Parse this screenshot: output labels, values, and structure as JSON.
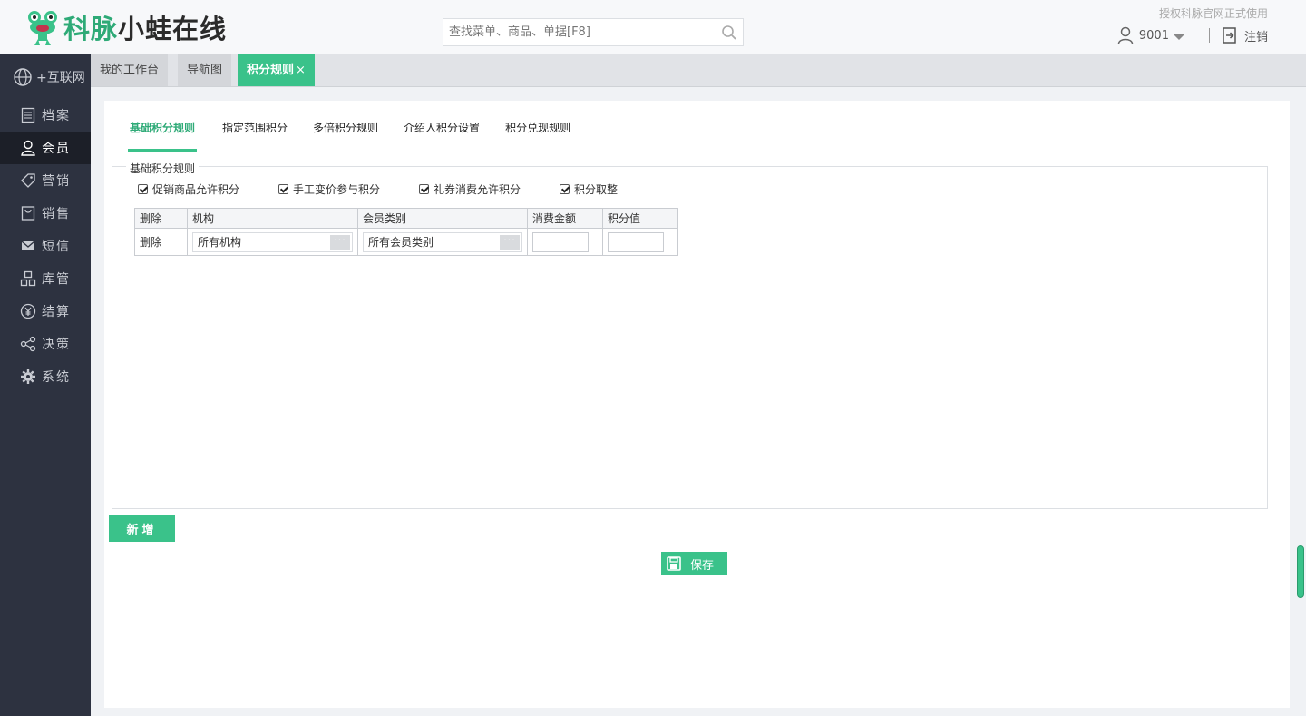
{
  "header": {
    "brand_green": "科脉",
    "brand_dark": "小蛙在线",
    "search_placeholder": "查找菜单、商品、单据[F8]",
    "authorized_text": "授权科脉官网正式使用",
    "user_id": "9001",
    "logout_label": "注销"
  },
  "sidebar": {
    "items": [
      {
        "label": "+互联网",
        "icon": "globe-icon"
      },
      {
        "label": "档案",
        "icon": "document-icon"
      },
      {
        "label": "会员",
        "icon": "user-icon"
      },
      {
        "label": "营销",
        "icon": "tag-icon"
      },
      {
        "label": "销售",
        "icon": "bag-icon"
      },
      {
        "label": "短信",
        "icon": "mail-icon"
      },
      {
        "label": "库管",
        "icon": "boxes-icon"
      },
      {
        "label": "结算",
        "icon": "yen-icon"
      },
      {
        "label": "决策",
        "icon": "share-icon"
      },
      {
        "label": "系统",
        "icon": "gear-icon"
      }
    ],
    "active_index": 2
  },
  "window_tabs": [
    {
      "label": "我的工作台"
    },
    {
      "label": "导航图"
    },
    {
      "label": "积分规则",
      "close": "×"
    }
  ],
  "sub_tabs": [
    "基础积分规则",
    "指定范围积分",
    "多倍积分规则",
    "介绍人积分设置",
    "积分兑现规则"
  ],
  "section": {
    "legend": "基础积分规则",
    "checkboxes": [
      {
        "label": "促销商品允许积分",
        "checked": true
      },
      {
        "label": "手工变价参与积分",
        "checked": true
      },
      {
        "label": "礼券消费允许积分",
        "checked": true
      },
      {
        "label": "积分取整",
        "checked": true
      }
    ]
  },
  "table": {
    "headers": [
      "删除",
      "机构",
      "会员类别",
      "消费金额",
      "积分值"
    ],
    "rows": [
      {
        "delete": "删除",
        "org": "所有机构",
        "member_type": "所有会员类别",
        "amount": "",
        "points": ""
      }
    ],
    "picker_button": "···"
  },
  "buttons": {
    "add": "新增",
    "save": "保存"
  },
  "colors": {
    "accent": "#3ac28a",
    "sidebar_bg": "#2d3240",
    "sidebar_active": "#1c1f28"
  }
}
